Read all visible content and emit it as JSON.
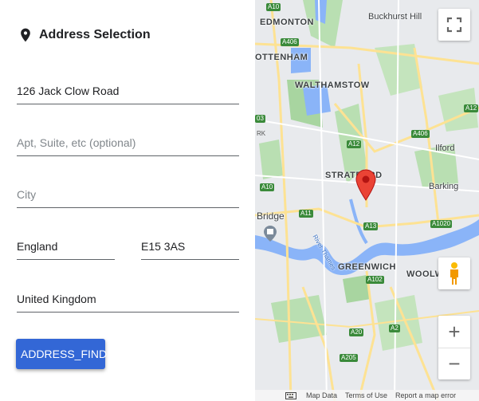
{
  "form": {
    "title": "Address Selection",
    "title_icon": "location-pin-icon",
    "street": {
      "value": "126 Jack Clow Road",
      "placeholder": ""
    },
    "apt": {
      "value": "",
      "placeholder": "Apt, Suite, etc (optional)"
    },
    "city": {
      "value": "",
      "placeholder": "City"
    },
    "region": {
      "value": "England",
      "placeholder": ""
    },
    "postcode": {
      "value": "E15 3AS",
      "placeholder": ""
    },
    "country": {
      "value": "United Kingdom",
      "placeholder": ""
    },
    "button_label": "ADDRESS_FIND",
    "button_color": "#3367d6"
  },
  "map": {
    "places": {
      "edmonton": "EDMONTON",
      "buckhurst_hill": "Buckhurst Hill",
      "tottenham": "OTTENHAM",
      "walthamstow": "WALTHAMSTOW",
      "ilford": "Ilford",
      "stratford": "STRATFORD",
      "barking": "Barking",
      "bridge": "Bridge",
      "greenwich": "GREENWICH",
      "woolwich": "WOOLW",
      "river": "River Thames"
    },
    "roads": {
      "a10_top": "A10",
      "a406": "A406",
      "a12_right": "A12",
      "a406_b": "A406",
      "a12": "A12",
      "a10": "A10",
      "a11": "A11",
      "a13": "A13",
      "a1020": "A1020",
      "a102": "A102",
      "a20": "A20",
      "a2": "A2",
      "a205": "A205",
      "a03": "03",
      "ark": "RK"
    },
    "controls": {
      "zoom_in": "+",
      "zoom_out": "−"
    },
    "footer": {
      "map_data": "Map Data",
      "terms": "Terms of Use",
      "report": "Report a map error"
    },
    "marker_color": "#ea4335"
  }
}
